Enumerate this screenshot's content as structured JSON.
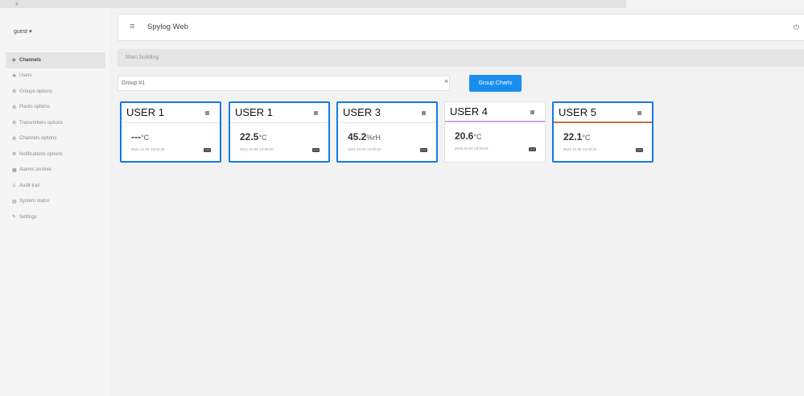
{
  "window": {
    "close_glyph": "x"
  },
  "user_menu": {
    "label": "guest ▾"
  },
  "sidebar": {
    "items": [
      {
        "icon": "◆",
        "label": "Channels",
        "active": true
      },
      {
        "icon": "❖",
        "label": "Users"
      },
      {
        "icon": "⚙",
        "label": "Groups options"
      },
      {
        "icon": "⚙",
        "label": "Plants options"
      },
      {
        "icon": "⚙",
        "label": "Transmitters options"
      },
      {
        "icon": "⚙",
        "label": "Channels options"
      },
      {
        "icon": "⚙",
        "label": "Notifications options"
      },
      {
        "icon": "▦",
        "label": "Alarms archive"
      },
      {
        "icon": "⚠",
        "label": "Audit trail"
      },
      {
        "icon": "▤",
        "label": "System status"
      },
      {
        "icon": "✎",
        "label": "Settings"
      }
    ]
  },
  "appbar": {
    "menu_icon": "≡",
    "title": "Spylog Web",
    "power_icon": "⏻"
  },
  "breadcrumb": {
    "text": "Main building"
  },
  "group": {
    "value": "Group #1",
    "clear": "×",
    "button": "Group Charts"
  },
  "cards": [
    {
      "name": "USER 1",
      "value": "---",
      "unit": "°C",
      "timestamp": "2021-11-02 15:00:30",
      "selected": true,
      "accent": null
    },
    {
      "name": "USER 1",
      "value": "22.5",
      "unit": "°C",
      "timestamp": "2021-10-20 13:00:00",
      "selected": true,
      "accent": null
    },
    {
      "name": "USER 3",
      "value": "45.2",
      "unit": "%rH",
      "timestamp": "2021-10-20 13:00:00",
      "selected": true,
      "accent": null
    },
    {
      "name": "USER 4",
      "value": "20.6",
      "unit": "°C",
      "timestamp": "2021-11-04 10:15:18",
      "selected": false,
      "accent": "#c9a6f0"
    },
    {
      "name": "USER 5",
      "value": "22.1",
      "unit": "°C",
      "timestamp": "2021-11-28 15:00:01",
      "selected": true,
      "accent": "#c0703a"
    }
  ]
}
